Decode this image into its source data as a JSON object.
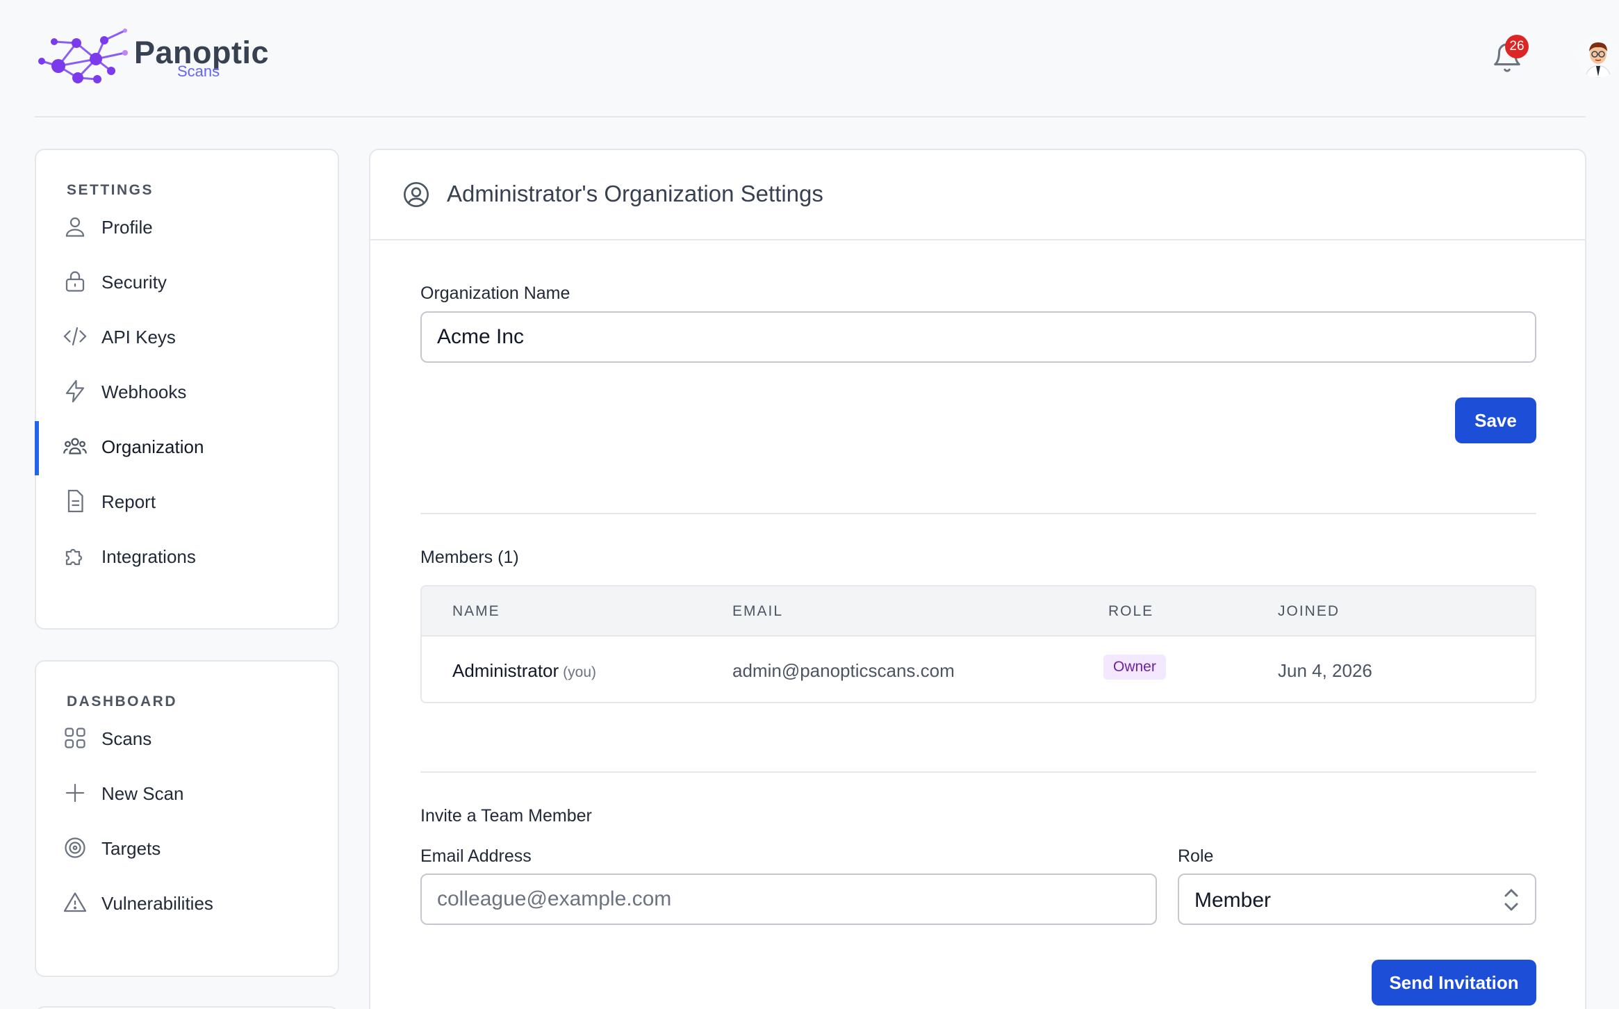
{
  "app": {
    "name": "Panoptic",
    "subtitle": "Scans",
    "notification_count": "26",
    "colors": {
      "accent": "#1d4ed8",
      "active_bar": "#2563eb",
      "badge_bg": "#f3e8ff",
      "badge_text": "#6b21a8",
      "notif": "#dc2626"
    }
  },
  "sidebar": {
    "settings_heading": "SETTINGS",
    "settings_items": [
      {
        "label": "Profile",
        "icon": "user-icon"
      },
      {
        "label": "Security",
        "icon": "lock-icon"
      },
      {
        "label": "API Keys",
        "icon": "code-icon"
      },
      {
        "label": "Webhooks",
        "icon": "bolt-icon"
      },
      {
        "label": "Organization",
        "icon": "users-icon",
        "active": true
      },
      {
        "label": "Report",
        "icon": "document-icon"
      },
      {
        "label": "Integrations",
        "icon": "puzzle-icon"
      }
    ],
    "dashboard_heading": "DASHBOARD",
    "dashboard_items": [
      {
        "label": "Scans",
        "icon": "grid-icon"
      },
      {
        "label": "New Scan",
        "icon": "plus-icon"
      },
      {
        "label": "Targets",
        "icon": "target-icon"
      },
      {
        "label": "Vulnerabilities",
        "icon": "warning-icon"
      }
    ]
  },
  "main": {
    "title": "Administrator's Organization Settings",
    "org_name_label": "Organization Name",
    "org_name_value": "Acme Inc",
    "save_label": "Save",
    "members_heading": "Members (1)",
    "table": {
      "headers": [
        "NAME",
        "EMAIL",
        "ROLE",
        "JOINED"
      ],
      "rows": [
        {
          "name": "Administrator",
          "you": "(you)",
          "email": "admin@panopticscans.com",
          "role": "Owner",
          "joined": "Jun 4, 2026"
        }
      ]
    },
    "invite": {
      "heading": "Invite a Team Member",
      "email_label": "Email Address",
      "email_placeholder": "colleague@example.com",
      "role_label": "Role",
      "role_value": "Member",
      "send_label": "Send Invitation"
    }
  }
}
